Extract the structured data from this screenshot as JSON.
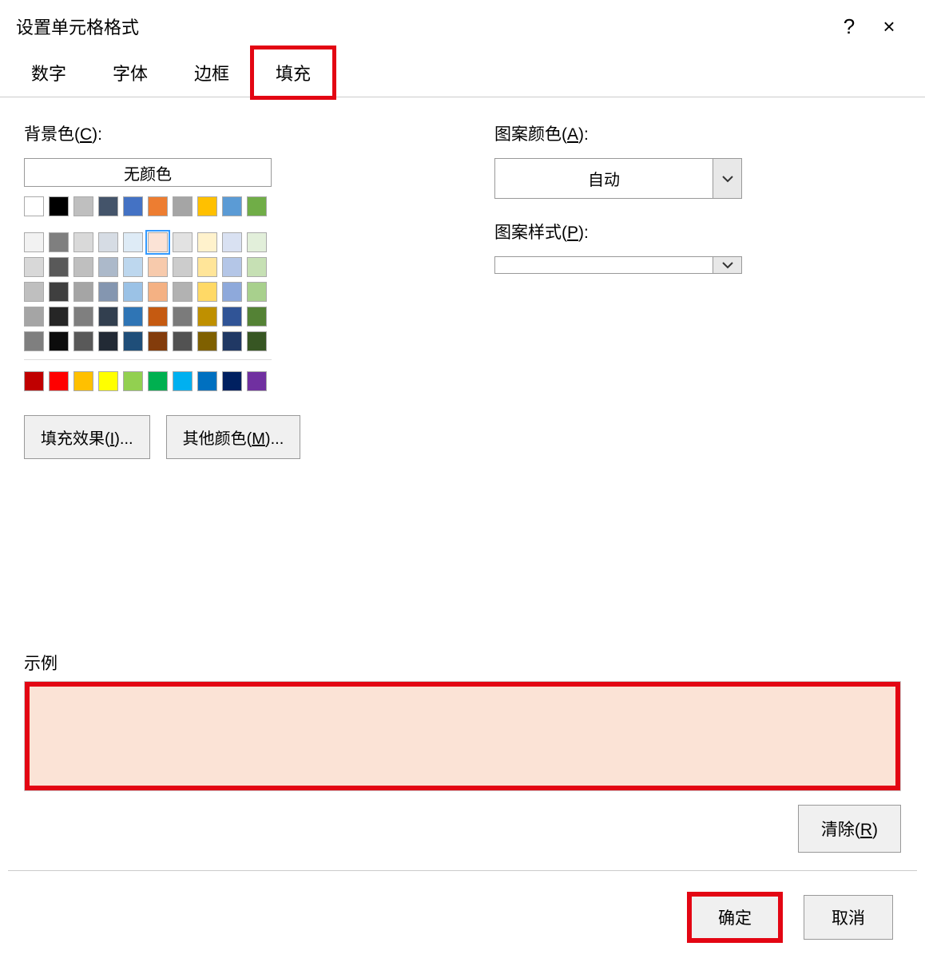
{
  "title": "设置单元格格式",
  "help_icon": "?",
  "close_icon": "×",
  "tabs": {
    "number": "数字",
    "font": "字体",
    "border": "边框",
    "fill": "填充"
  },
  "bg_color_label_pre": "背景色(",
  "bg_color_hotkey": "C",
  "bg_color_label_post": "):",
  "no_color": "无颜色",
  "fill_effects_pre": "填充效果(",
  "fill_effects_hotkey": "I",
  "fill_effects_post": ")...",
  "more_colors_pre": "其他颜色(",
  "more_colors_hotkey": "M",
  "more_colors_post": ")...",
  "pattern_color_label_pre": "图案颜色(",
  "pattern_color_hotkey": "A",
  "pattern_color_label_post": "):",
  "pattern_auto": "自动",
  "pattern_style_label_pre": "图案样式(",
  "pattern_style_hotkey": "P",
  "pattern_style_label_post": "):",
  "example_label": "示例",
  "clear_pre": "清除(",
  "clear_hotkey": "R",
  "clear_post": ")",
  "ok": "确定",
  "cancel": "取消",
  "selected_color": "#fbe3d6",
  "theme_row": [
    "#ffffff",
    "#000000",
    "#bfbfbf",
    "#44546a",
    "#4472c4",
    "#ed7d31",
    "#a5a5a5",
    "#ffc000",
    "#5b9bd5",
    "#70ad47"
  ],
  "tint_rows": [
    [
      "#f2f2f2",
      "#7f7f7f",
      "#d9d9d9",
      "#d6dce4",
      "#deebf6",
      "#fbe3d6",
      "#e2e2e2",
      "#fff2cc",
      "#d9e1f2",
      "#e2efda"
    ],
    [
      "#d8d8d8",
      "#595959",
      "#bfbfbf",
      "#acb9ca",
      "#bdd7ee",
      "#f7caac",
      "#cccccc",
      "#ffe599",
      "#b4c6e7",
      "#c6e0b4"
    ],
    [
      "#bfbfbf",
      "#3f3f3f",
      "#a5a5a5",
      "#8496b0",
      "#9bc2e6",
      "#f4b183",
      "#b2b2b2",
      "#ffd966",
      "#8ea9db",
      "#a8d08d"
    ],
    [
      "#a5a5a5",
      "#262626",
      "#7f7f7f",
      "#323f4f",
      "#2f75b5",
      "#c55a11",
      "#7b7b7b",
      "#bf9000",
      "#305496",
      "#548235"
    ],
    [
      "#7f7f7f",
      "#0c0c0c",
      "#595959",
      "#222a35",
      "#1f4e79",
      "#833c0b",
      "#525252",
      "#7f6000",
      "#203864",
      "#375623"
    ]
  ],
  "standard_row": [
    "#c00000",
    "#ff0000",
    "#ffc000",
    "#ffff00",
    "#92d050",
    "#00b050",
    "#00b0f0",
    "#0070c0",
    "#002060",
    "#7030a0"
  ]
}
